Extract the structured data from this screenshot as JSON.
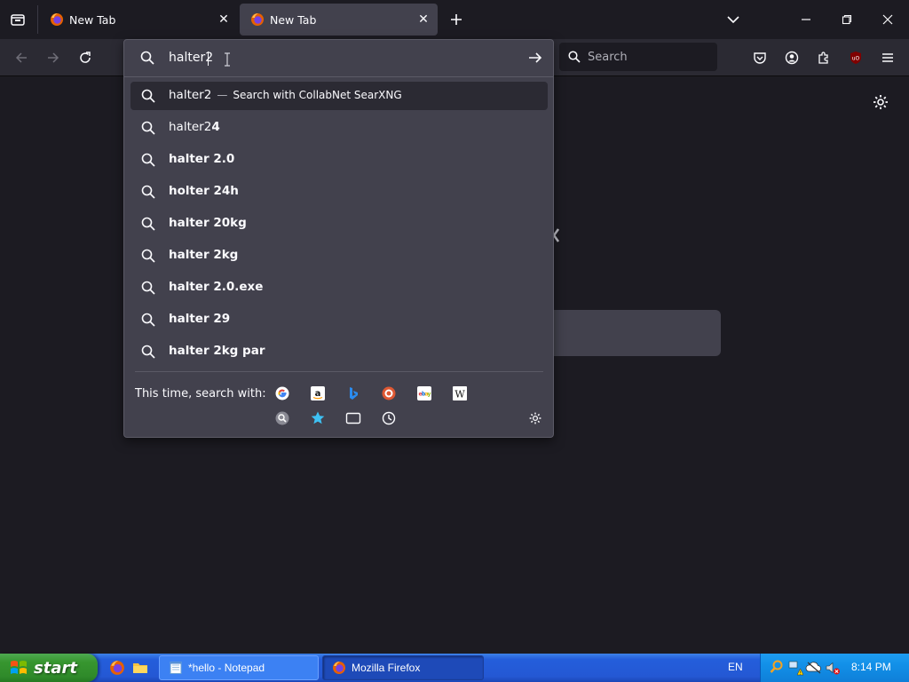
{
  "tabs": [
    {
      "title": "New Tab"
    },
    {
      "title": "New Tab"
    }
  ],
  "toolbar": {
    "search_placeholder": "Search"
  },
  "urlbar": {
    "input_value": "halter2",
    "heuristic": {
      "query": "halter2",
      "action": "Search with CollabNet SearXNG"
    },
    "suggestions": [
      {
        "typed": "halter2",
        "completion": "4"
      },
      {
        "typed": "",
        "completion": "halter 2.0"
      },
      {
        "typed": "",
        "completion": "holter 24h"
      },
      {
        "typed": "",
        "completion": "halter 20kg"
      },
      {
        "typed": "",
        "completion": "halter 2kg"
      },
      {
        "typed": "",
        "completion": "halter 2.0.exe"
      },
      {
        "typed": "",
        "completion": "halter 29"
      },
      {
        "typed": "",
        "completion": "halter 2kg par"
      }
    ],
    "one_off_label": "This time, search with:",
    "engines": [
      "google-icon",
      "amazon-icon",
      "bing-icon",
      "duckduckgo-icon",
      "ebay-icon",
      "wikipedia-icon",
      "searxng-icon",
      "bookmarks-icon",
      "tabs-icon",
      "history-icon"
    ]
  },
  "taskbar": {
    "start_label": "start",
    "tasks": [
      {
        "label": "*hello - Notepad"
      },
      {
        "label": "Mozilla Firefox"
      }
    ],
    "language": "EN",
    "clock": "8:14 PM"
  },
  "colors": {
    "chrome_bg": "#1c1b22",
    "toolbar_bg": "#2b2a33",
    "panel_bg": "#42414d",
    "xp_blue": "#245edb",
    "xp_start_green": "#37962f"
  }
}
